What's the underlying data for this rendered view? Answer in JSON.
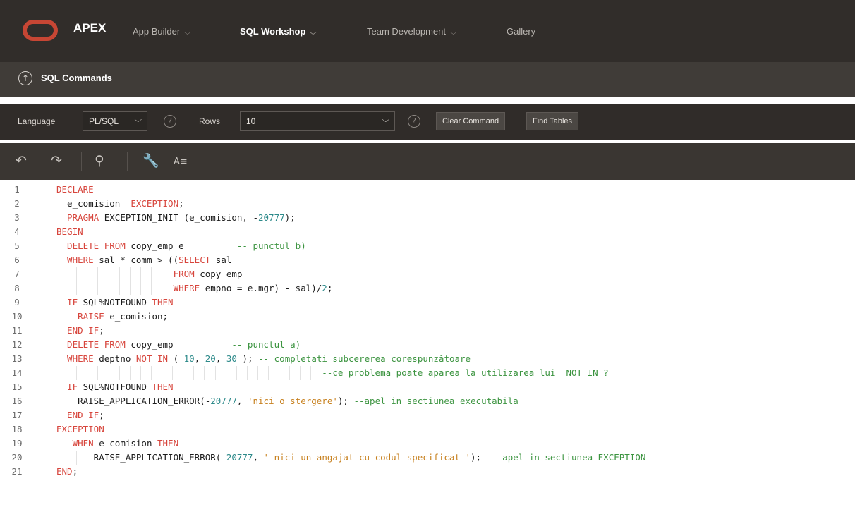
{
  "topnav": {
    "brand": "APEX",
    "items": [
      {
        "label": "App Builder",
        "active": false
      },
      {
        "label": "SQL Workshop",
        "active": true
      },
      {
        "label": "Team Development",
        "active": false
      },
      {
        "label": "Gallery",
        "active": false
      }
    ]
  },
  "breadcrumb": {
    "title": "SQL Commands"
  },
  "options": {
    "language_label": "Language",
    "language_value": "PL/SQL",
    "rows_label": "Rows",
    "rows_value": "10",
    "help_glyph": "?",
    "clear_button": "Clear Command",
    "find_tables_button": "Find Tables"
  },
  "editor_toolbar": {
    "icons": [
      "undo-icon",
      "redo-icon",
      "search-icon",
      "wrench-icon",
      "format-icon"
    ],
    "format_glyph": "A≡"
  },
  "colors": {
    "nav_bg": "#312d2a",
    "brand_red": "#c74634",
    "keyword": "#d7453c",
    "comment": "#3c9440",
    "number": "#2d8a8a",
    "string": "#c7801e"
  },
  "code_lines": [
    {
      "n": "1",
      "tokens": [
        {
          "t": "kw",
          "v": "DECLARE"
        }
      ]
    },
    {
      "n": "2",
      "tokens": [
        {
          "t": "id",
          "v": "  e_comision  "
        },
        {
          "t": "kw",
          "v": "EXCEPTION"
        },
        {
          "t": "id",
          "v": ";"
        }
      ]
    },
    {
      "n": "3",
      "tokens": [
        {
          "t": "kw",
          "v": "  PRAGMA"
        },
        {
          "t": "id",
          "v": " EXCEPTION_INIT (e_comision, -"
        },
        {
          "t": "num",
          "v": "20777"
        },
        {
          "t": "id",
          "v": ");"
        }
      ]
    },
    {
      "n": "4",
      "tokens": [
        {
          "t": "kw",
          "v": "BEGIN"
        }
      ]
    },
    {
      "n": "5",
      "tokens": [
        {
          "t": "kw",
          "v": "  DELETE FROM"
        },
        {
          "t": "id",
          "v": " copy_emp e          "
        },
        {
          "t": "cmt",
          "v": "-- punctul b)"
        }
      ]
    },
    {
      "n": "6",
      "tokens": [
        {
          "t": "kw",
          "v": "  WHERE"
        },
        {
          "t": "id",
          "v": " sal * comm > (("
        },
        {
          "t": "kw",
          "v": "SELECT"
        },
        {
          "t": "id",
          "v": " sal"
        }
      ]
    },
    {
      "n": "7",
      "tokens": [
        {
          "t": "kw",
          "v": "                      FROM"
        },
        {
          "t": "id",
          "v": " copy_emp"
        }
      ]
    },
    {
      "n": "8",
      "tokens": [
        {
          "t": "kw",
          "v": "                      WHERE"
        },
        {
          "t": "id",
          "v": " empno = e.mgr) - sal)/"
        },
        {
          "t": "num",
          "v": "2"
        },
        {
          "t": "id",
          "v": ";"
        }
      ]
    },
    {
      "n": "9",
      "tokens": [
        {
          "t": "kw",
          "v": "  IF"
        },
        {
          "t": "id",
          "v": " SQL%NOTFOUND "
        },
        {
          "t": "kw",
          "v": "THEN"
        }
      ]
    },
    {
      "n": "10",
      "tokens": [
        {
          "t": "kw",
          "v": "    RAISE"
        },
        {
          "t": "id",
          "v": " e_comision;"
        }
      ]
    },
    {
      "n": "11",
      "tokens": [
        {
          "t": "kw",
          "v": "  END IF"
        },
        {
          "t": "id",
          "v": ";"
        }
      ]
    },
    {
      "n": "12",
      "tokens": [
        {
          "t": "kw",
          "v": "  DELETE FROM"
        },
        {
          "t": "id",
          "v": " copy_emp           "
        },
        {
          "t": "cmt",
          "v": "-- punctul a)"
        }
      ]
    },
    {
      "n": "13",
      "tokens": [
        {
          "t": "kw",
          "v": "  WHERE"
        },
        {
          "t": "id",
          "v": " deptno "
        },
        {
          "t": "kw",
          "v": "NOT IN"
        },
        {
          "t": "id",
          "v": " ( "
        },
        {
          "t": "num",
          "v": "10"
        },
        {
          "t": "id",
          "v": ", "
        },
        {
          "t": "num",
          "v": "20"
        },
        {
          "t": "id",
          "v": ", "
        },
        {
          "t": "num",
          "v": "30"
        },
        {
          "t": "id",
          "v": " ); "
        },
        {
          "t": "cmt",
          "v": "-- completati subcererea corespunzătoare"
        }
      ]
    },
    {
      "n": "14",
      "tokens": [
        {
          "t": "cmt",
          "v": "                                                  --ce problema poate aparea la utilizarea lui  NOT IN ?"
        }
      ]
    },
    {
      "n": "15",
      "tokens": [
        {
          "t": "kw",
          "v": "  IF"
        },
        {
          "t": "id",
          "v": " SQL%NOTFOUND "
        },
        {
          "t": "kw",
          "v": "THEN"
        }
      ]
    },
    {
      "n": "16",
      "tokens": [
        {
          "t": "id",
          "v": "    RAISE_APPLICATION_ERROR(-"
        },
        {
          "t": "num",
          "v": "20777"
        },
        {
          "t": "id",
          "v": ", "
        },
        {
          "t": "str",
          "v": "'nici o stergere'"
        },
        {
          "t": "id",
          "v": "); "
        },
        {
          "t": "cmt",
          "v": "--apel in sectiunea executabila"
        }
      ]
    },
    {
      "n": "17",
      "tokens": [
        {
          "t": "kw",
          "v": "  END IF"
        },
        {
          "t": "id",
          "v": ";"
        }
      ]
    },
    {
      "n": "18",
      "tokens": [
        {
          "t": "kw",
          "v": "EXCEPTION"
        }
      ]
    },
    {
      "n": "19",
      "tokens": [
        {
          "t": "kw",
          "v": "   WHEN"
        },
        {
          "t": "id",
          "v": " e_comision "
        },
        {
          "t": "kw",
          "v": "THEN"
        }
      ]
    },
    {
      "n": "20",
      "tokens": [
        {
          "t": "id",
          "v": "       RAISE_APPLICATION_ERROR(-"
        },
        {
          "t": "num",
          "v": "20777"
        },
        {
          "t": "id",
          "v": ", "
        },
        {
          "t": "str",
          "v": "' nici un angajat cu codul specificat '"
        },
        {
          "t": "id",
          "v": "); "
        },
        {
          "t": "cmt",
          "v": "-- apel in sectiunea EXCEPTION"
        }
      ]
    },
    {
      "n": "21",
      "tokens": [
        {
          "t": "kw",
          "v": "END"
        },
        {
          "t": "id",
          "v": ";"
        }
      ]
    }
  ]
}
